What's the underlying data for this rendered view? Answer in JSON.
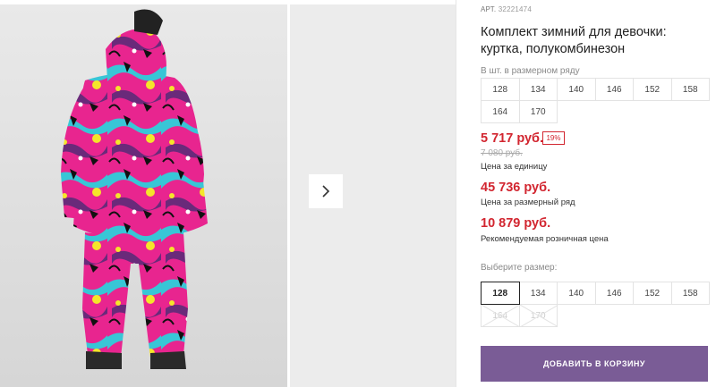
{
  "product": {
    "art_label": "АРТ.",
    "art_number": "32221474",
    "title": "Комплект зимний для девочки: куртка, полукомбинезон"
  },
  "size_row": {
    "label": "В шт. в размерном ряду",
    "sizes": [
      "128",
      "134",
      "140",
      "146",
      "152",
      "158",
      "164",
      "170"
    ]
  },
  "pricing": {
    "unit_price": "5 717 руб.",
    "discount_badge": "19%",
    "old_price": "7 080 руб.",
    "unit_price_label": "Цена за единицу",
    "row_price": "45 736 руб.",
    "row_price_label": "Цена за размерный ряд",
    "retail_price": "10 879 руб.",
    "retail_price_label": "Рекомендуемая розничная цена"
  },
  "size_select": {
    "label": "Выберите размер:",
    "selected": "128",
    "sizes": [
      "128",
      "134",
      "140",
      "146",
      "152",
      "158",
      "164",
      "170"
    ],
    "disabled": [
      "164",
      "170"
    ]
  },
  "cart": {
    "button_label": "ДОБАВИТЬ В КОРЗИНУ"
  },
  "icons": {
    "next": "chevron-right-icon"
  },
  "colors": {
    "accent": "#7a5c96",
    "price_red": "#d22630"
  }
}
